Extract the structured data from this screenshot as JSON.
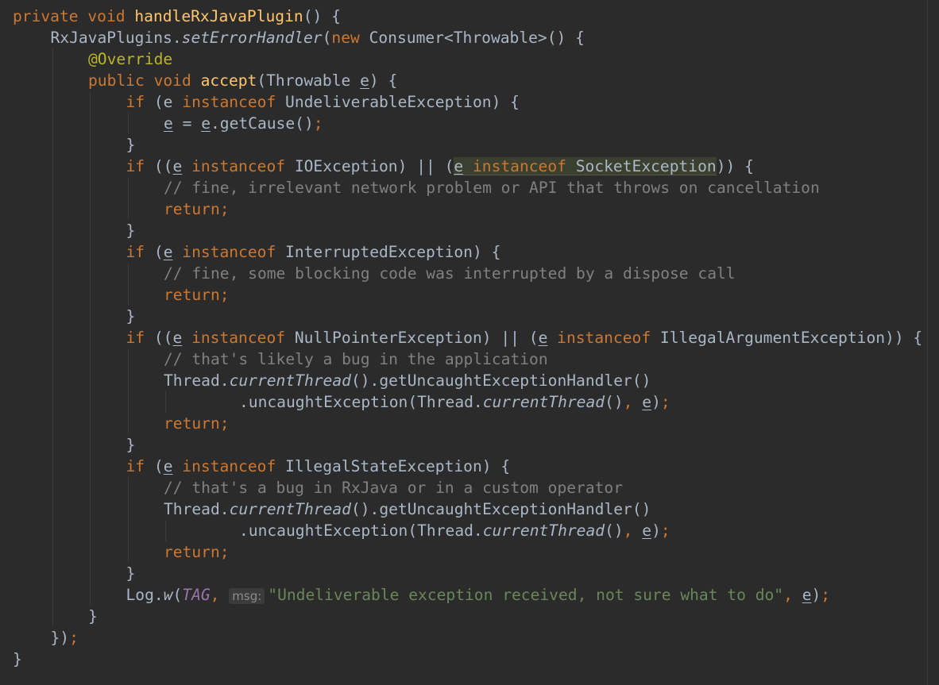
{
  "editor": {
    "lines": [
      {
        "indent": 0,
        "tokens": [
          {
            "t": "private",
            "c": "kw"
          },
          {
            "t": " "
          },
          {
            "t": "void",
            "c": "kw"
          },
          {
            "t": " "
          },
          {
            "t": "handleRxJavaPlugin",
            "c": "fn"
          },
          {
            "t": "() {"
          }
        ]
      },
      {
        "indent": 1,
        "tokens": [
          {
            "t": "RxJavaPlugins."
          },
          {
            "t": "setErrorHandler",
            "c": "it"
          },
          {
            "t": "("
          },
          {
            "t": "new",
            "c": "kw"
          },
          {
            "t": " Consumer<Throwable>() {"
          }
        ]
      },
      {
        "indent": 2,
        "tokens": [
          {
            "t": "@Override",
            "c": "ann"
          }
        ]
      },
      {
        "indent": 2,
        "tokens": [
          {
            "t": "public",
            "c": "kw"
          },
          {
            "t": " "
          },
          {
            "t": "void",
            "c": "kw"
          },
          {
            "t": " "
          },
          {
            "t": "accept",
            "c": "fn"
          },
          {
            "t": "(Throwable "
          },
          {
            "t": "e",
            "c": "ul"
          },
          {
            "t": ") {"
          }
        ]
      },
      {
        "indent": 3,
        "tokens": [
          {
            "t": "if",
            "c": "kw"
          },
          {
            "t": " (e "
          },
          {
            "t": "instanceof",
            "c": "kw"
          },
          {
            "t": " UndeliverableException) {"
          }
        ]
      },
      {
        "indent": 4,
        "tokens": [
          {
            "t": "e",
            "c": "ul"
          },
          {
            "t": " = "
          },
          {
            "t": "e",
            "c": "ul"
          },
          {
            "t": ".getCause()"
          },
          {
            "t": ";",
            "c": "kw"
          }
        ]
      },
      {
        "indent": 3,
        "tokens": [
          {
            "t": "}"
          }
        ]
      },
      {
        "indent": 3,
        "tokens": [
          {
            "t": "if",
            "c": "kw"
          },
          {
            "t": " (("
          },
          {
            "t": "e",
            "c": "ul"
          },
          {
            "t": " "
          },
          {
            "t": "instanceof",
            "c": "kw"
          },
          {
            "t": " IOException) || ("
          },
          {
            "t": "e",
            "c": "ul hl"
          },
          {
            "t": " ",
            "c": "hl"
          },
          {
            "t": "instanceof",
            "c": "kw hl"
          },
          {
            "t": " SocketException",
            "c": "hl"
          },
          {
            "t": ")) {"
          }
        ]
      },
      {
        "indent": 4,
        "tokens": [
          {
            "t": "// fine, irrelevant network problem or API that throws on cancellation",
            "c": "cm"
          }
        ]
      },
      {
        "indent": 4,
        "tokens": [
          {
            "t": "return",
            "c": "kw"
          },
          {
            "t": ";",
            "c": "kw"
          }
        ]
      },
      {
        "indent": 3,
        "tokens": [
          {
            "t": "}"
          }
        ]
      },
      {
        "indent": 3,
        "tokens": [
          {
            "t": "if",
            "c": "kw"
          },
          {
            "t": " ("
          },
          {
            "t": "e",
            "c": "ul"
          },
          {
            "t": " "
          },
          {
            "t": "instanceof",
            "c": "kw"
          },
          {
            "t": " InterruptedException) {"
          }
        ]
      },
      {
        "indent": 4,
        "tokens": [
          {
            "t": "// fine, some blocking code was interrupted by a dispose call",
            "c": "cm"
          }
        ]
      },
      {
        "indent": 4,
        "tokens": [
          {
            "t": "return",
            "c": "kw"
          },
          {
            "t": ";",
            "c": "kw"
          }
        ]
      },
      {
        "indent": 3,
        "tokens": [
          {
            "t": "}"
          }
        ]
      },
      {
        "indent": 3,
        "tokens": [
          {
            "t": "if",
            "c": "kw"
          },
          {
            "t": " (("
          },
          {
            "t": "e",
            "c": "ul"
          },
          {
            "t": " "
          },
          {
            "t": "instanceof",
            "c": "kw"
          },
          {
            "t": " NullPointerException) || ("
          },
          {
            "t": "e",
            "c": "ul"
          },
          {
            "t": " "
          },
          {
            "t": "instanceof",
            "c": "kw"
          },
          {
            "t": " IllegalArgumentException)) {"
          }
        ]
      },
      {
        "indent": 4,
        "tokens": [
          {
            "t": "// that's likely a bug in the application",
            "c": "cm"
          }
        ]
      },
      {
        "indent": 4,
        "tokens": [
          {
            "t": "Thread."
          },
          {
            "t": "currentThread",
            "c": "it"
          },
          {
            "t": "().getUncaughtExceptionHandler()"
          }
        ]
      },
      {
        "indent": 4,
        "extra": 8,
        "tokens": [
          {
            "t": ".uncaughtException(Thread."
          },
          {
            "t": "currentThread",
            "c": "it"
          },
          {
            "t": "()"
          },
          {
            "t": ",",
            "c": "kw"
          },
          {
            "t": " "
          },
          {
            "t": "e",
            "c": "ul"
          },
          {
            "t": ")"
          },
          {
            "t": ";",
            "c": "kw"
          }
        ]
      },
      {
        "indent": 4,
        "tokens": [
          {
            "t": "return",
            "c": "kw"
          },
          {
            "t": ";",
            "c": "kw"
          }
        ]
      },
      {
        "indent": 3,
        "tokens": [
          {
            "t": "}"
          }
        ]
      },
      {
        "indent": 3,
        "tokens": [
          {
            "t": "if",
            "c": "kw"
          },
          {
            "t": " ("
          },
          {
            "t": "e",
            "c": "ul"
          },
          {
            "t": " "
          },
          {
            "t": "instanceof",
            "c": "kw"
          },
          {
            "t": " IllegalStateException) {"
          }
        ]
      },
      {
        "indent": 4,
        "tokens": [
          {
            "t": "// that's a bug in RxJava or in a custom operator",
            "c": "cm"
          }
        ]
      },
      {
        "indent": 4,
        "tokens": [
          {
            "t": "Thread."
          },
          {
            "t": "currentThread",
            "c": "it"
          },
          {
            "t": "().getUncaughtExceptionHandler()"
          }
        ]
      },
      {
        "indent": 4,
        "extra": 8,
        "tokens": [
          {
            "t": ".uncaughtException(Thread."
          },
          {
            "t": "currentThread",
            "c": "it"
          },
          {
            "t": "()"
          },
          {
            "t": ",",
            "c": "kw"
          },
          {
            "t": " "
          },
          {
            "t": "e",
            "c": "ul"
          },
          {
            "t": ")"
          },
          {
            "t": ";",
            "c": "kw"
          }
        ]
      },
      {
        "indent": 4,
        "tokens": [
          {
            "t": "return",
            "c": "kw"
          },
          {
            "t": ";",
            "c": "kw"
          }
        ]
      },
      {
        "indent": 3,
        "tokens": [
          {
            "t": "}"
          }
        ]
      },
      {
        "indent": 3,
        "tokens": [
          {
            "t": "Log."
          },
          {
            "t": "w",
            "c": "it"
          },
          {
            "t": "("
          },
          {
            "t": "TAG",
            "c": "const"
          },
          {
            "t": ",",
            "c": "kw"
          },
          {
            "t": " "
          },
          {
            "t": "msg:",
            "c": "hint"
          },
          {
            "t": "\"Undeliverable exception received, not sure what to do\"",
            "c": "str"
          },
          {
            "t": ",",
            "c": "kw"
          },
          {
            "t": " "
          },
          {
            "t": "e",
            "c": "ul"
          },
          {
            "t": ")"
          },
          {
            "t": ";",
            "c": "kw"
          }
        ]
      },
      {
        "indent": 2,
        "tokens": [
          {
            "t": "}"
          }
        ]
      },
      {
        "indent": 1,
        "tokens": [
          {
            "t": "})"
          },
          {
            "t": ";",
            "c": "kw"
          }
        ]
      },
      {
        "indent": 0,
        "tokens": [
          {
            "t": "}"
          }
        ]
      }
    ]
  }
}
